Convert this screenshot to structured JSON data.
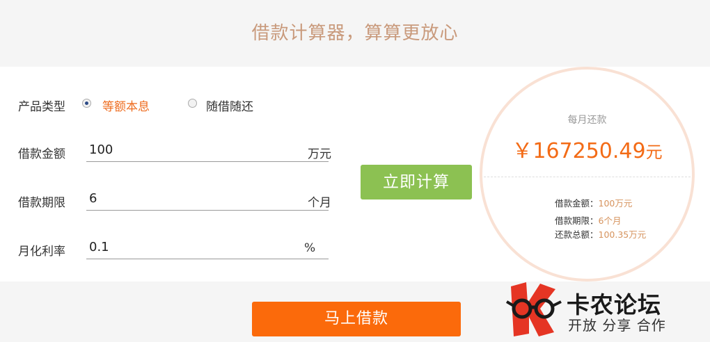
{
  "header": {
    "title": "借款计算器，算算更放心"
  },
  "form": {
    "product_type_label": "产品类型",
    "options": [
      {
        "label": "等额本息",
        "selected": true
      },
      {
        "label": "随借随还",
        "selected": false
      }
    ],
    "amount": {
      "label": "借款金额",
      "value": "100",
      "unit": "万元"
    },
    "term": {
      "label": "借款期限",
      "value": "6",
      "unit": "个月"
    },
    "rate": {
      "label": "月化利率",
      "value": "0.1",
      "unit": "%"
    },
    "calculate_label": "立即计算"
  },
  "result": {
    "monthly_label": "每月还款",
    "currency_symbol": "￥",
    "monthly_amount": "167250.49",
    "monthly_unit": "元",
    "details": [
      {
        "label": "借款金额：",
        "value": "100万元"
      },
      {
        "label": "借款期限：",
        "value": "6个月"
      },
      {
        "label": "还款总额：",
        "value": "100.35万元"
      }
    ]
  },
  "borrow_label": "马上借款",
  "watermark": {
    "name": "卡农论坛",
    "slogan": "开放 分享 合作"
  },
  "colors": {
    "accent_orange": "#f36b16",
    "button_green": "#8cc152",
    "title_tan": "#c99a7c"
  }
}
